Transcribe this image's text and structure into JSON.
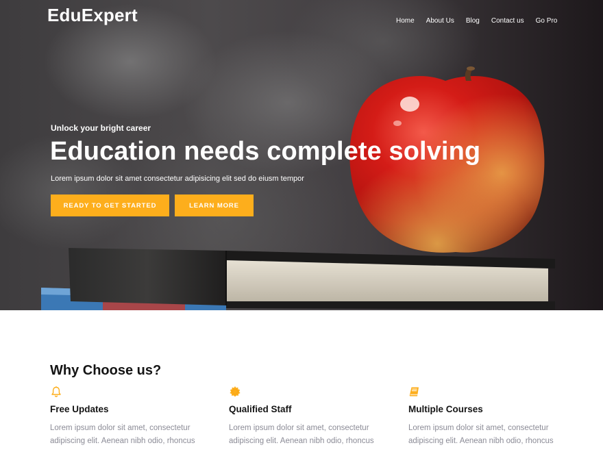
{
  "brand": {
    "name": "EduExpert"
  },
  "nav": {
    "items": [
      {
        "label": "Home"
      },
      {
        "label": "About Us"
      },
      {
        "label": "Blog"
      },
      {
        "label": "Contact us"
      },
      {
        "label": "Go Pro"
      }
    ]
  },
  "hero": {
    "subtitle": "Unlock your bright career",
    "title": "Education needs complete solving",
    "text": "Lorem ipsum dolor sit amet consectetur adipisicing elit sed do eiusm tempor",
    "primary_button": "READY TO GET STARTED",
    "secondary_button": "LEARN MORE",
    "background_icon": "apple-on-books-image"
  },
  "features": {
    "title": "Why Choose us?",
    "items": [
      {
        "icon": "bell-icon",
        "title": "Free Updates",
        "text": "Lorem ipsum dolor sit amet, consectetur adipiscing elit. Aenean nibh odio, rhoncus"
      },
      {
        "icon": "sun-badge-icon",
        "title": "Qualified Staff",
        "text": "Lorem ipsum dolor sit amet, consectetur adipiscing elit. Aenean nibh odio, rhoncus"
      },
      {
        "icon": "book-icon",
        "title": "Multiple Courses",
        "text": "Lorem ipsum dolor sit amet, consectetur adipiscing elit. Aenean nibh odio, rhoncus"
      }
    ]
  },
  "colors": {
    "accent": "#fdae1c",
    "muted_text": "#8b8b96",
    "heading": "#141414"
  }
}
